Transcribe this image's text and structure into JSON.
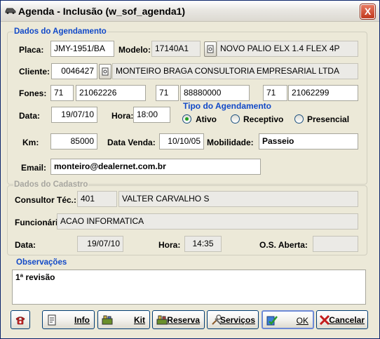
{
  "window": {
    "title": "Agenda - Inclusão (w_sof_agenda1)",
    "close": "X"
  },
  "agendamento": {
    "group_title": "Dados do Agendamento",
    "placa_label": "Placa:",
    "placa": "JMY-1951/BA",
    "modelo_label": "Modelo:",
    "modelo_code": "17140A1",
    "modelo_desc": "NOVO PALIO ELX 1.4 FLEX 4P",
    "cliente_label": "Cliente:",
    "cliente_code": "0046427",
    "cliente_name": "MONTEIRO BRAGA CONSULTORIA EMPRESARIAL LTDA",
    "fones_label": "Fones:",
    "fones": [
      {
        "ddd": "71",
        "num": "21062226"
      },
      {
        "ddd": "71",
        "num": "88880000"
      },
      {
        "ddd": "71",
        "num": "21062299"
      }
    ],
    "data_label": "Data:",
    "data": "19/07/10",
    "hora_label": "Hora:",
    "hora": "18:00",
    "tipo_title": "Tipo do Agendamento",
    "tipo_options": [
      "Ativo",
      "Receptivo",
      "Presencial"
    ],
    "tipo_selected": "Ativo",
    "km_label": "Km:",
    "km": "85000",
    "data_venda_label": "Data Venda:",
    "data_venda": "10/10/05",
    "mobilidade_label": "Mobilidade:",
    "mobilidade": "Passeio",
    "email_label": "Email:",
    "email": "monteiro@dealernet.com.br"
  },
  "cadastro": {
    "group_title": "Dados do Cadastro",
    "consultor_label": "Consultor Téc.:",
    "consultor_code": "401",
    "consultor_name": "VALTER CARVALHO S",
    "funcionario_label": "Funcionário:",
    "funcionario": "ACAO INFORMATICA",
    "data_label": "Data:",
    "data": "19/07/10",
    "hora_label": "Hora:",
    "hora": "14:35",
    "os_label": "O.S. Aberta:",
    "os": ""
  },
  "observacoes": {
    "label": "Observações",
    "text": "1ª revisão"
  },
  "buttons": {
    "info": "Info",
    "kit": "Kit",
    "reserva": "Reserva",
    "servicos": "Serviços",
    "ok": "OK",
    "cancelar": "Cancelar"
  },
  "colors": {
    "group_title": "#1149c8",
    "disabled_title": "#a7a6a0",
    "window_bg": "#ece9d8"
  }
}
